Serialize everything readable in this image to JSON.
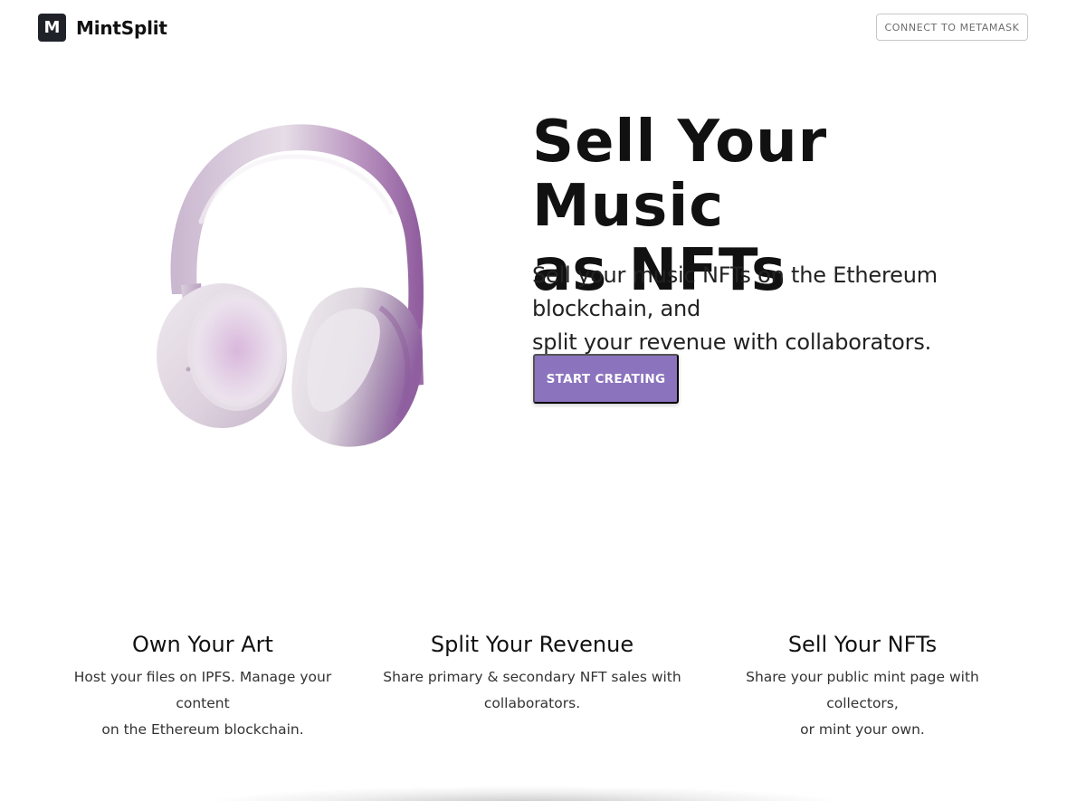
{
  "header": {
    "logo_letter": "M",
    "brand": "MintSplit",
    "connect_label": "CONNECT TO METAMASK"
  },
  "hero": {
    "image": "headphones-image",
    "title_line1": "Sell Your Music",
    "title_line2": "as NFTs",
    "subtitle_line1": "Sell your music NFTs on the Ethereum blockchain, and",
    "subtitle_line2": "split your revenue with collaborators.",
    "cta_label": "START CREATING"
  },
  "features": [
    {
      "title": "Own Your Art",
      "line1": "Host your files on IPFS. Manage your content",
      "line2": "on the Ethereum blockchain."
    },
    {
      "title": "Split Your Revenue",
      "line1": "Share primary & secondary NFT sales with",
      "line2": "collaborators."
    },
    {
      "title": "Sell Your NFTs",
      "line1": "Share your public mint page with collectors,",
      "line2": "or mint your own."
    }
  ],
  "colors": {
    "accent": "#8b73be",
    "logo_bg": "#1f2329",
    "text": "#111111"
  }
}
